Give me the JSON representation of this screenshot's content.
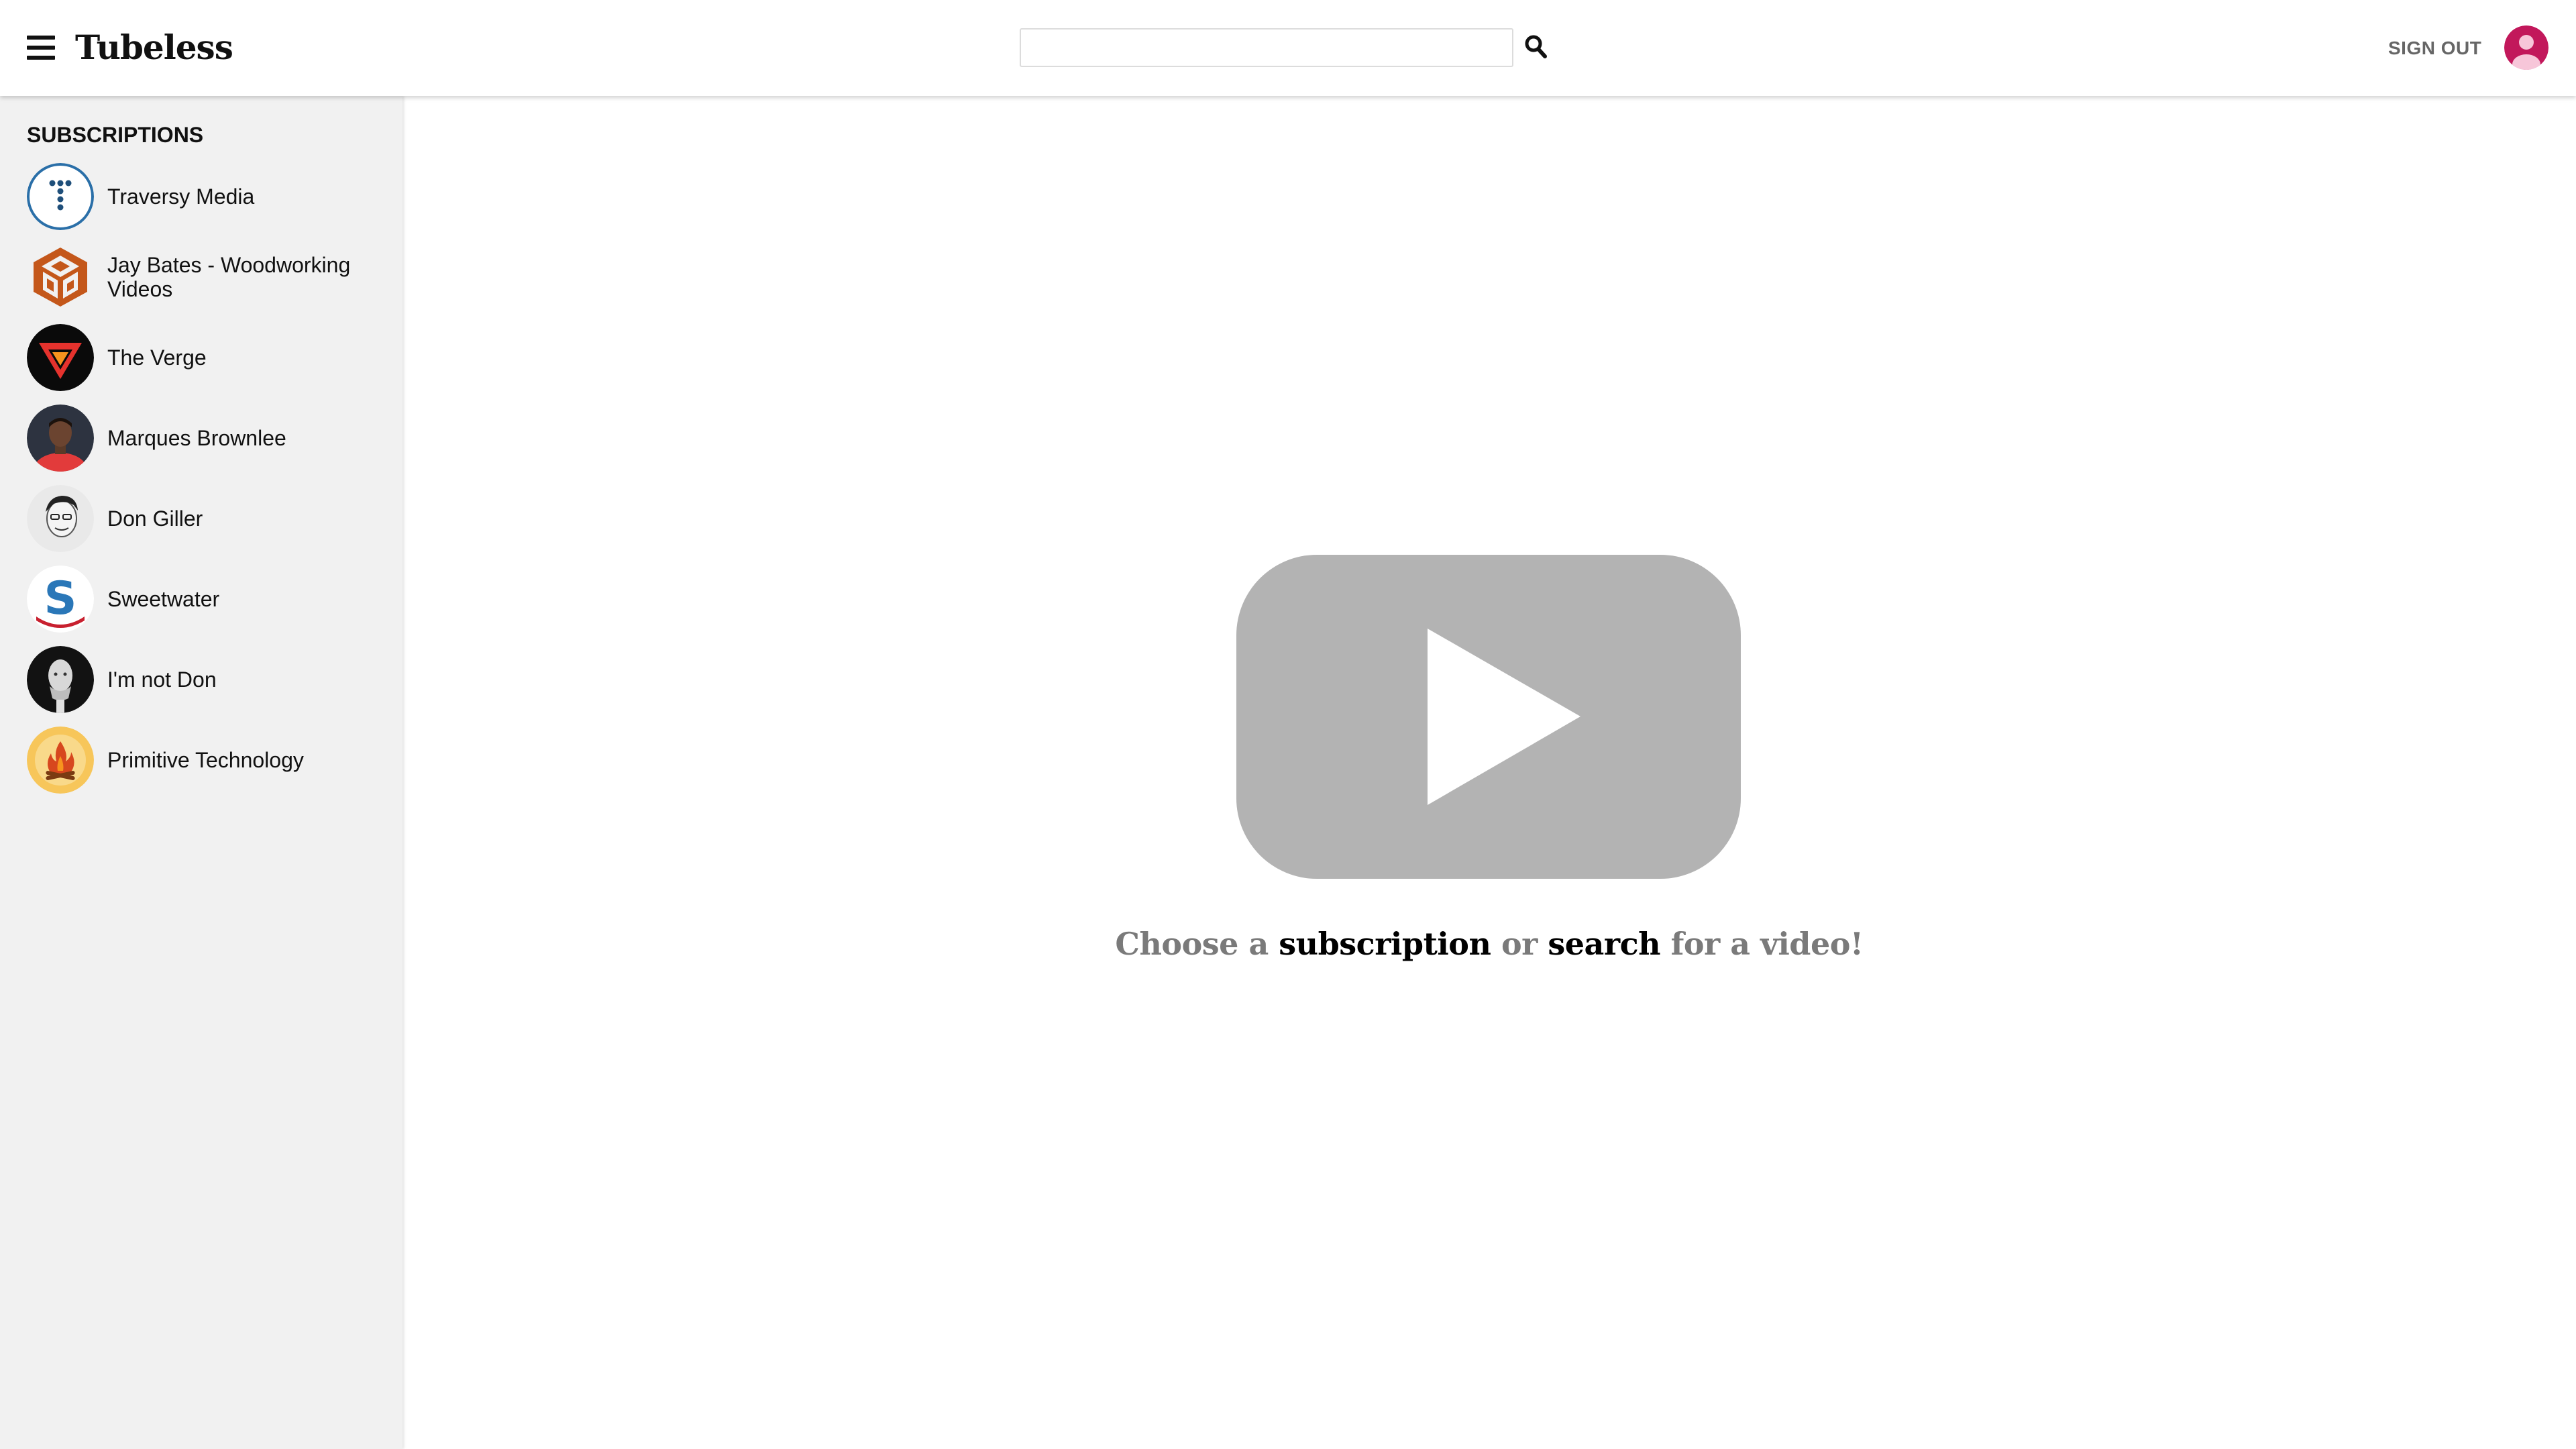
{
  "header": {
    "app_title": "Tubeless",
    "search_placeholder": "",
    "search_value": "",
    "signout_label": "SIGN OUT",
    "avatar_color": "#c2185b"
  },
  "sidebar": {
    "heading": "SUBSCRIPTIONS",
    "items": [
      {
        "label": "Traversy Media"
      },
      {
        "label": "Jay Bates - Woodworking Videos"
      },
      {
        "label": "The Verge"
      },
      {
        "label": "Marques Brownlee"
      },
      {
        "label": "Don Giller"
      },
      {
        "label": "Sweetwater"
      },
      {
        "label": "I'm not Don"
      },
      {
        "label": "Primitive Technology"
      }
    ]
  },
  "main": {
    "prompt_part1": "Choose a",
    "prompt_link1": "subscription",
    "prompt_part2": "or",
    "prompt_link2": "search",
    "prompt_part3": "for a video!",
    "logo_color": "#b3b3b3"
  }
}
